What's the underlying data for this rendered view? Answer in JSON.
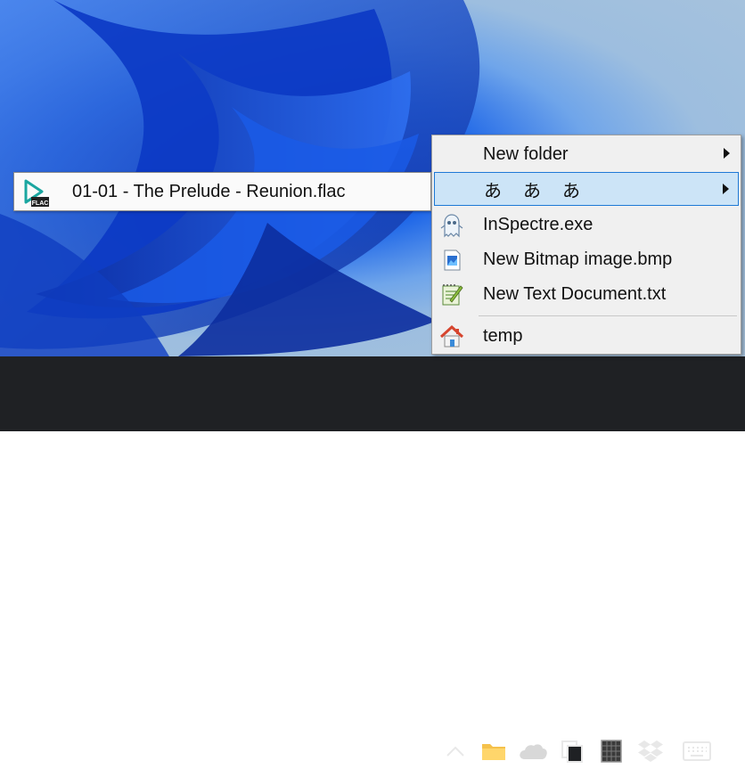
{
  "tooltip": {
    "label": "01-01 - The Prelude - Reunion.flac",
    "icon": "flac-file-icon",
    "badge": "FLAC"
  },
  "menu": {
    "items": [
      {
        "label": "New folder",
        "icon": "none",
        "submenu": true
      },
      {
        "label": "あ　あ　あ",
        "icon": "none",
        "submenu": true,
        "highlighted": true
      },
      {
        "label": "InSpectre.exe",
        "icon": "ghost-icon"
      },
      {
        "label": "New Bitmap image.bmp",
        "icon": "bitmap-file-icon"
      },
      {
        "label": "New Text Document.txt",
        "icon": "notepad-icon"
      },
      {
        "label": "temp",
        "icon": "home-icon"
      }
    ]
  },
  "taskbar": {
    "tray_icons": [
      "chevron-up-icon",
      "folder-icon",
      "onedrive-cloud-icon",
      "copy-icon",
      "grid-icon",
      "dropbox-icon",
      "keyboard-icon"
    ]
  },
  "colors": {
    "highlight_bg": "#cce4f7",
    "highlight_border": "#1e79d6",
    "taskbar_bg": "#1f2124",
    "menu_bg": "#f0f0f0"
  }
}
